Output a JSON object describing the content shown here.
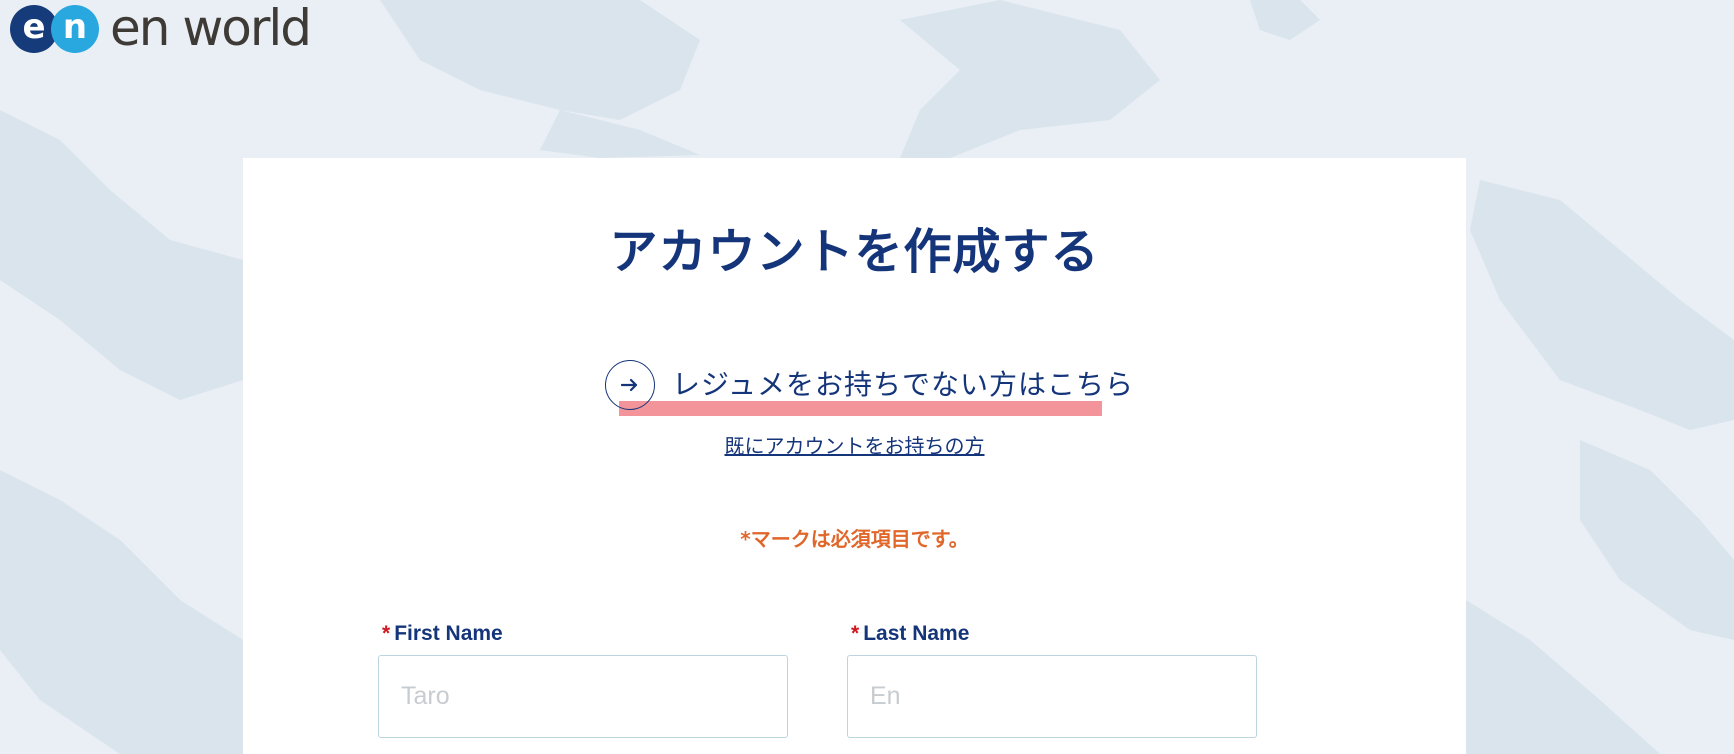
{
  "logo": {
    "mark_e": "e",
    "mark_n": "n",
    "text": "en world"
  },
  "page": {
    "title": "アカウントを作成する",
    "resume_link": "レジュメをお持ちでない方はこちら",
    "login_link": "既にアカウントをお持ちの方",
    "required_note": "*マークは必須項目です。"
  },
  "form": {
    "first_name": {
      "required_mark": "*",
      "label": "First Name",
      "placeholder": "Taro",
      "value": ""
    },
    "last_name": {
      "required_mark": "*",
      "label": "Last Name",
      "placeholder": "En",
      "value": ""
    }
  },
  "colors": {
    "brand_navy": "#15357a",
    "brand_blue": "#29a8e0",
    "accent_orange": "#e0662a",
    "required_red": "#d0161f",
    "highlight_pink": "#f2949a"
  },
  "icons": {
    "resume_link_icon": "arrow-right-icon"
  }
}
